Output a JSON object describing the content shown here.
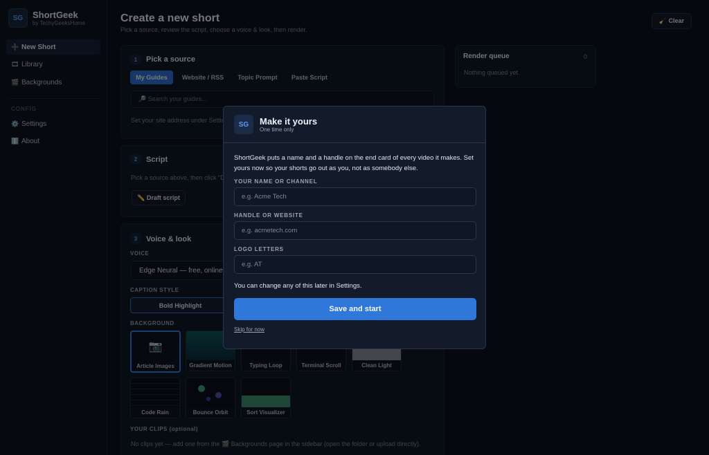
{
  "app": {
    "logo": "SG",
    "name": "ShortGeek",
    "byline": "by TechyGeeksHome"
  },
  "sidebar": {
    "items": [
      {
        "icon": "➕",
        "label": "New Short"
      },
      {
        "icon": "🎞",
        "label": "Library"
      },
      {
        "icon": "🎬",
        "label": "Backgrounds"
      }
    ],
    "config_label": "CONFIG",
    "config_items": [
      {
        "icon": "⚙️",
        "label": "Settings"
      },
      {
        "icon": "ℹ️",
        "label": "About"
      }
    ]
  },
  "header": {
    "title": "Create a new short",
    "subtitle": "Pick a source, review the script, choose a voice & look, then render.",
    "clear_label": "🧹 Clear"
  },
  "source": {
    "step": "1",
    "title": "Pick a source",
    "tabs": [
      "My Guides",
      "Website / RSS",
      "Topic Prompt",
      "Paste Script"
    ],
    "search_placeholder": "🔎 Search your guides...",
    "hint": "Set your site address under Settings"
  },
  "script": {
    "step": "2",
    "title": "Script",
    "hint": "Pick a source above, then click \"D",
    "draft_label": "✏️ Draft script"
  },
  "voice": {
    "step": "3",
    "title": "Voice & look",
    "voice_label": "VOICE",
    "voice_value": "Edge Neural — free, online, t",
    "caption_label": "CAPTION STYLE",
    "caption_value": "Bold Highlight",
    "background_label": "BACKGROUND",
    "backgrounds": [
      "Article Images",
      "Gradient Motion",
      "Typing Loop",
      "Terminal Scroll",
      "Clean Light",
      "Code Rain",
      "Bounce Orbit",
      "Sort Visualizer"
    ],
    "clips_label": "YOUR CLIPS (optional)",
    "clips_hint": "No clips yet — add one from the 🎬 Backgrounds page in the sidebar (open the folder or upload directly)."
  },
  "queue": {
    "title": "Render queue",
    "count": "0",
    "empty": "Nothing queued yet."
  },
  "modal": {
    "logo": "SG",
    "title": "Make it yours",
    "subtitle": "One time only",
    "body": "ShortGeek puts a name and a handle on the end card of every video it makes. Set yours now so your shorts go out as you, not as somebody else.",
    "name_label": "YOUR NAME OR CHANNEL",
    "name_placeholder": "e.g. Acme Tech",
    "handle_label": "HANDLE OR WEBSITE",
    "handle_placeholder": "e.g. acmetech.com",
    "logo_label": "LOGO LETTERS",
    "logo_placeholder": "e.g. AT",
    "note": "You can change any of this later in Settings.",
    "save_label": "Save and start",
    "skip_label": "Skip for now"
  }
}
